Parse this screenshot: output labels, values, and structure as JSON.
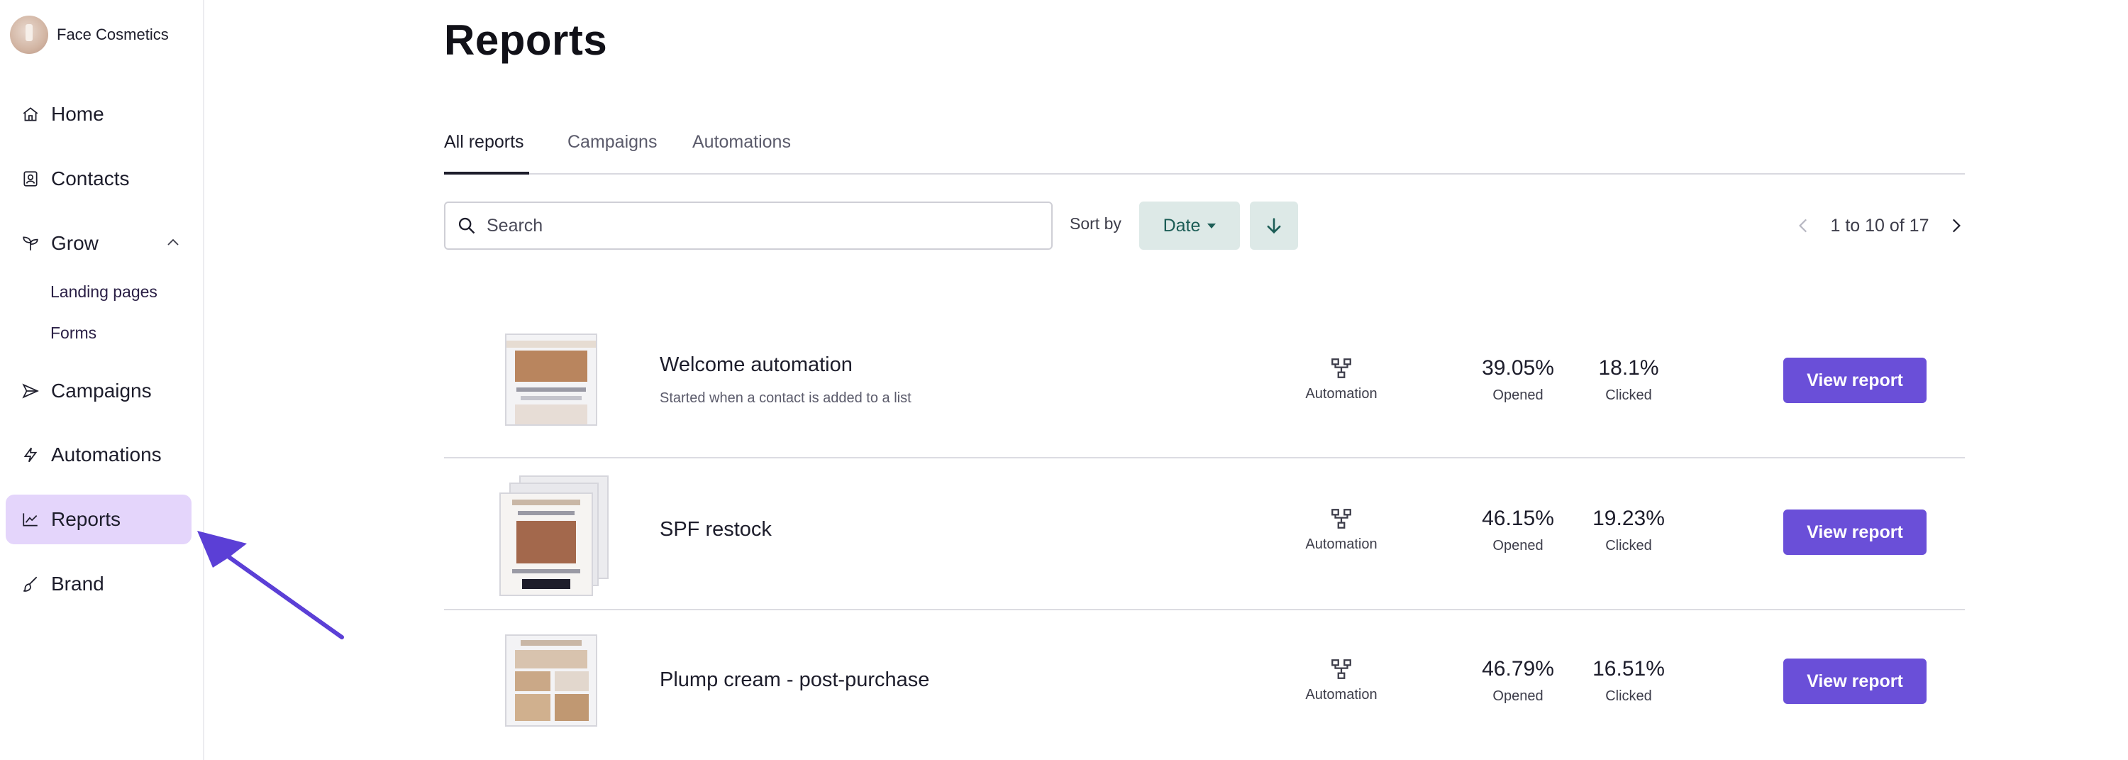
{
  "brand": {
    "name": "Face Cosmetics"
  },
  "sidebar": {
    "items": [
      {
        "label": "Home",
        "icon": "home-icon"
      },
      {
        "label": "Contacts",
        "icon": "contacts-icon"
      },
      {
        "label": "Grow",
        "icon": "sprout-icon",
        "expanded": true,
        "children": [
          {
            "label": "Landing pages"
          },
          {
            "label": "Forms"
          }
        ]
      },
      {
        "label": "Campaigns",
        "icon": "send-icon"
      },
      {
        "label": "Automations",
        "icon": "lightning-icon"
      },
      {
        "label": "Reports",
        "icon": "chart-line-icon",
        "active": true
      },
      {
        "label": "Brand",
        "icon": "brush-icon"
      }
    ],
    "active_color": "#e4d5fb"
  },
  "page": {
    "title": "Reports"
  },
  "tabs": [
    {
      "label": "All reports",
      "active": true
    },
    {
      "label": "Campaigns"
    },
    {
      "label": "Automations"
    }
  ],
  "toolbar": {
    "search_placeholder": "Search",
    "sort_label": "Sort by",
    "sort_value": "Date",
    "sort_direction": "descending",
    "pagination": "1 to 10 of 17"
  },
  "reports": [
    {
      "title": "Welcome automation",
      "subtitle": "Started when a contact is added to a list",
      "type": "Automation",
      "opened": "39.05%",
      "opened_label": "Opened",
      "clicked": "18.1%",
      "clicked_label": "Clicked",
      "action": "View report"
    },
    {
      "title": "SPF restock",
      "subtitle": "",
      "type": "Automation",
      "opened": "46.15%",
      "opened_label": "Opened",
      "clicked": "19.23%",
      "clicked_label": "Clicked",
      "action": "View report"
    },
    {
      "title": "Plump cream - post-purchase",
      "subtitle": "",
      "type": "Automation",
      "opened": "46.79%",
      "opened_label": "Opened",
      "clicked": "16.51%",
      "clicked_label": "Clicked",
      "action": "View report"
    }
  ],
  "colors": {
    "primary_button": "#6a4fd8",
    "sort_button_bg": "#dde9e7",
    "annotation_arrow": "#5b3fd6"
  }
}
